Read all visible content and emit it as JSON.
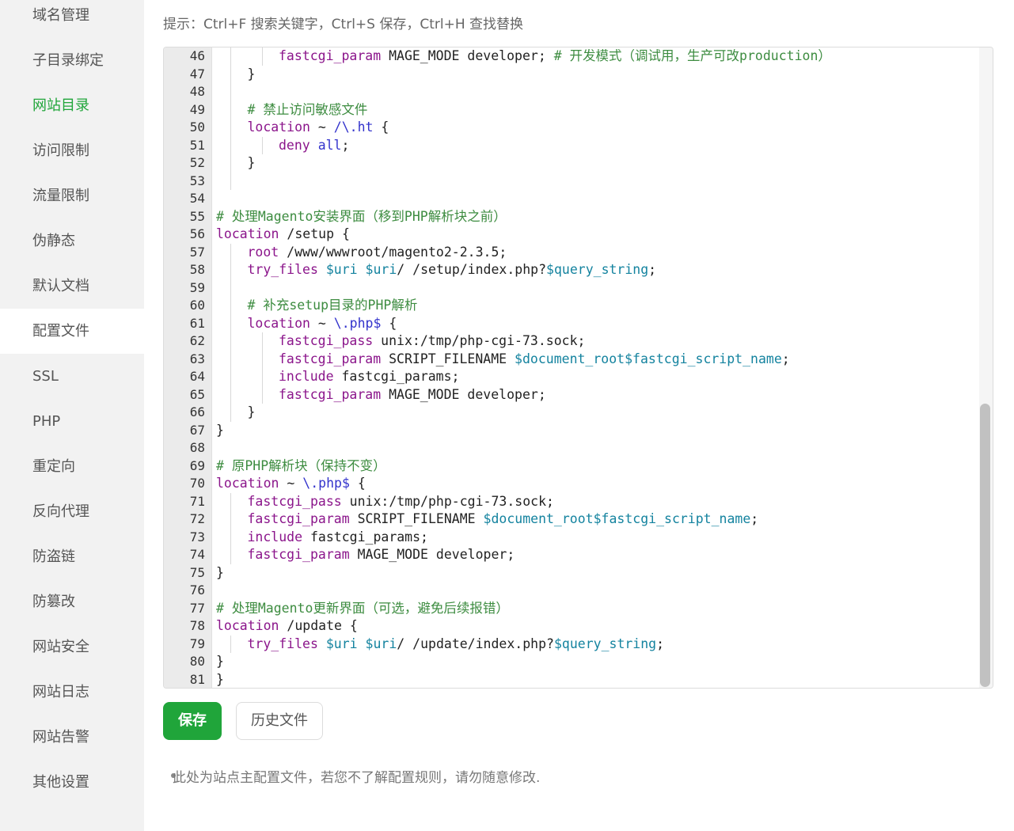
{
  "sidebar": {
    "items": [
      {
        "label": "域名管理"
      },
      {
        "label": "子目录绑定"
      },
      {
        "label": "网站目录"
      },
      {
        "label": "访问限制"
      },
      {
        "label": "流量限制"
      },
      {
        "label": "伪静态"
      },
      {
        "label": "默认文档"
      },
      {
        "label": "配置文件"
      },
      {
        "label": "SSL"
      },
      {
        "label": "PHP"
      },
      {
        "label": "重定向"
      },
      {
        "label": "反向代理"
      },
      {
        "label": "防盗链"
      },
      {
        "label": "防篡改"
      },
      {
        "label": "网站安全"
      },
      {
        "label": "网站日志"
      },
      {
        "label": "网站告警"
      },
      {
        "label": "其他设置"
      }
    ],
    "highlighted_item": "网站目录",
    "selected_item": "配置文件"
  },
  "main": {
    "hint": "提示：Ctrl+F 搜索关键字，Ctrl+S 保存，Ctrl+H 查找替换",
    "save_button": "保存",
    "history_button": "历史文件",
    "note": "此处为站点主配置文件，若您不了解配置规则，请勿随意修改."
  },
  "editor": {
    "lines": [
      {
        "n": "46",
        "indent": 2,
        "tokens": [
          [
            "kw",
            "fastcgi_param"
          ],
          [
            "pl",
            " MAGE_MODE developer; "
          ],
          [
            "cm",
            "# 开发模式（调试用，生产可改production）"
          ]
        ]
      },
      {
        "n": "47",
        "indent": 1,
        "tokens": [
          [
            "pl",
            "}"
          ]
        ]
      },
      {
        "n": "48",
        "indent": 1,
        "tokens": []
      },
      {
        "n": "49",
        "indent": 1,
        "tokens": [
          [
            "cm",
            "# 禁止访问敏感文件"
          ]
        ]
      },
      {
        "n": "50",
        "indent": 1,
        "tokens": [
          [
            "kw",
            "location"
          ],
          [
            "pl",
            " ~ "
          ],
          [
            "bl",
            "/\\.ht"
          ],
          [
            "pl",
            " {"
          ]
        ]
      },
      {
        "n": "51",
        "indent": 2,
        "tokens": [
          [
            "kw",
            "deny"
          ],
          [
            "pl",
            " "
          ],
          [
            "bl",
            "all"
          ],
          [
            "pl",
            ";"
          ]
        ]
      },
      {
        "n": "52",
        "indent": 1,
        "tokens": [
          [
            "pl",
            "}"
          ]
        ]
      },
      {
        "n": "53",
        "indent": 1,
        "tokens": []
      },
      {
        "n": "54",
        "indent": 0,
        "tokens": []
      },
      {
        "n": "55",
        "indent": 0,
        "tokens": [
          [
            "cm",
            "# 处理Magento安装界面（移到PHP解析块之前）"
          ]
        ]
      },
      {
        "n": "56",
        "indent": 0,
        "tokens": [
          [
            "kw",
            "location"
          ],
          [
            "pl",
            " /setup {"
          ]
        ]
      },
      {
        "n": "57",
        "indent": 1,
        "tokens": [
          [
            "kw",
            "root"
          ],
          [
            "pl",
            " /www/wwwroot/magento2-2.3.5;"
          ]
        ]
      },
      {
        "n": "58",
        "indent": 1,
        "tokens": [
          [
            "kw",
            "try_files"
          ],
          [
            "pl",
            " "
          ],
          [
            "var",
            "$uri"
          ],
          [
            "pl",
            " "
          ],
          [
            "var",
            "$uri"
          ],
          [
            "pl",
            "/ /setup/index.php?"
          ],
          [
            "var",
            "$query_string"
          ],
          [
            "pl",
            ";"
          ]
        ]
      },
      {
        "n": "59",
        "indent": 1,
        "tokens": []
      },
      {
        "n": "60",
        "indent": 1,
        "tokens": [
          [
            "cm",
            "# 补充setup目录的PHP解析"
          ]
        ]
      },
      {
        "n": "61",
        "indent": 1,
        "tokens": [
          [
            "kw",
            "location"
          ],
          [
            "pl",
            " ~ "
          ],
          [
            "bl",
            "\\.php$"
          ],
          [
            "pl",
            " {"
          ]
        ]
      },
      {
        "n": "62",
        "indent": 2,
        "tokens": [
          [
            "kw",
            "fastcgi_pass"
          ],
          [
            "pl",
            " unix:/tmp/php-cgi-73.sock;"
          ]
        ]
      },
      {
        "n": "63",
        "indent": 2,
        "tokens": [
          [
            "kw",
            "fastcgi_param"
          ],
          [
            "pl",
            " SCRIPT_FILENAME "
          ],
          [
            "var",
            "$document_root$fastcgi_script_name"
          ],
          [
            "pl",
            ";"
          ]
        ]
      },
      {
        "n": "64",
        "indent": 2,
        "tokens": [
          [
            "kw",
            "include"
          ],
          [
            "pl",
            " fastcgi_params;"
          ]
        ]
      },
      {
        "n": "65",
        "indent": 2,
        "tokens": [
          [
            "kw",
            "fastcgi_param"
          ],
          [
            "pl",
            " MAGE_MODE developer;"
          ]
        ]
      },
      {
        "n": "66",
        "indent": 1,
        "tokens": [
          [
            "pl",
            "}"
          ]
        ]
      },
      {
        "n": "67",
        "indent": 0,
        "tokens": [
          [
            "pl",
            "}"
          ]
        ]
      },
      {
        "n": "68",
        "indent": 0,
        "tokens": []
      },
      {
        "n": "69",
        "indent": 0,
        "tokens": [
          [
            "cm",
            "# 原PHP解析块（保持不变）"
          ]
        ]
      },
      {
        "n": "70",
        "indent": 0,
        "tokens": [
          [
            "kw",
            "location"
          ],
          [
            "pl",
            " ~ "
          ],
          [
            "bl",
            "\\.php$"
          ],
          [
            "pl",
            " {"
          ]
        ]
      },
      {
        "n": "71",
        "indent": 1,
        "tokens": [
          [
            "kw",
            "fastcgi_pass"
          ],
          [
            "pl",
            " unix:/tmp/php-cgi-73.sock;"
          ]
        ]
      },
      {
        "n": "72",
        "indent": 1,
        "tokens": [
          [
            "kw",
            "fastcgi_param"
          ],
          [
            "pl",
            " SCRIPT_FILENAME "
          ],
          [
            "var",
            "$document_root$fastcgi_script_name"
          ],
          [
            "pl",
            ";"
          ]
        ]
      },
      {
        "n": "73",
        "indent": 1,
        "tokens": [
          [
            "kw",
            "include"
          ],
          [
            "pl",
            " fastcgi_params;"
          ]
        ]
      },
      {
        "n": "74",
        "indent": 1,
        "tokens": [
          [
            "kw",
            "fastcgi_param"
          ],
          [
            "pl",
            " MAGE_MODE developer;"
          ]
        ]
      },
      {
        "n": "75",
        "indent": 0,
        "tokens": [
          [
            "pl",
            "}"
          ]
        ]
      },
      {
        "n": "76",
        "indent": 0,
        "tokens": []
      },
      {
        "n": "77",
        "indent": 0,
        "tokens": [
          [
            "cm",
            "# 处理Magento更新界面（可选，避免后续报错）"
          ]
        ]
      },
      {
        "n": "78",
        "indent": 0,
        "tokens": [
          [
            "kw",
            "location"
          ],
          [
            "pl",
            " /update {"
          ]
        ]
      },
      {
        "n": "79",
        "indent": 1,
        "tokens": [
          [
            "kw",
            "try_files"
          ],
          [
            "pl",
            " "
          ],
          [
            "var",
            "$uri"
          ],
          [
            "pl",
            " "
          ],
          [
            "var",
            "$uri"
          ],
          [
            "pl",
            "/ /update/index.php?"
          ],
          [
            "var",
            "$query_string"
          ],
          [
            "pl",
            ";"
          ]
        ]
      },
      {
        "n": "80",
        "indent": 0,
        "tokens": [
          [
            "pl",
            "}"
          ]
        ]
      },
      {
        "n": "81",
        "indent": 0,
        "tokens": [
          [
            "pl",
            "}"
          ]
        ]
      }
    ]
  },
  "colors": {
    "accent": "#20a53a",
    "keyword": "#8b158b",
    "variable": "#14839f",
    "comment": "#3d8c40",
    "sidebar_bg": "#f2f2f2"
  }
}
